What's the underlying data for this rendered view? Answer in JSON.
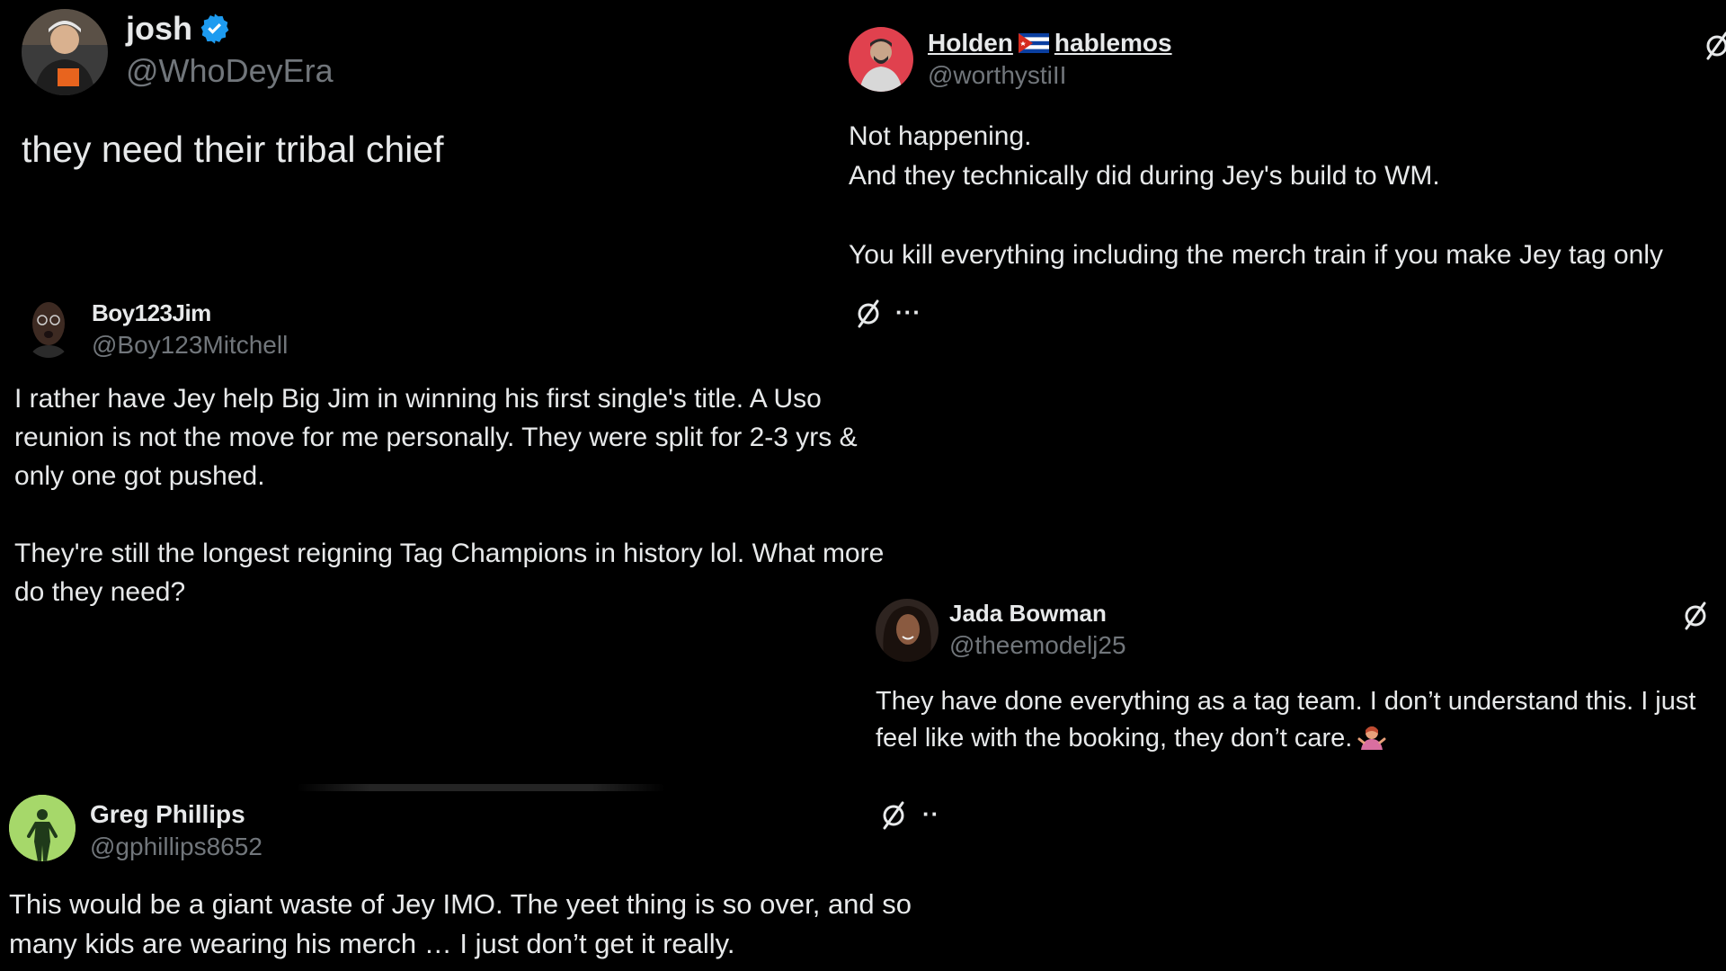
{
  "posts": {
    "josh": {
      "name": "josh",
      "handle": "@WhoDeyEra",
      "text": "they need their tribal chief"
    },
    "holden": {
      "name_part1": "Holden",
      "name_part2": "hablemos",
      "handle": "@worthystiII",
      "text": "Not happening.\nAnd they technically did during Jey's build to WM.\n\nYou kill everything including the merch train if you make Jey tag only"
    },
    "boy123": {
      "name": "Boy123Jim",
      "handle": "@Boy123Mitchell",
      "text": "I rather have Jey help Big Jim in winning his first single's title. A Uso\nreunion is not the move for me personally. They were split for 2-3 yrs &\nonly one got pushed.\n\nThey're still the longest reigning Tag Champions in history lol. What more\ndo they need?",
      "more": "···"
    },
    "jada": {
      "name": "Jada Bowman",
      "handle": "@theemodelj25",
      "text": "They have done everything as a tag team. I don’t understand this. I just\nfeel like with the booking, they don’t care."
    },
    "greg": {
      "name": "Greg Phillips",
      "handle": "@gphillips8652",
      "text": "This would be a giant waste of Jey IMO. The yeet thing is so over, and so\nmany kids are wearing his merch … I just don’t get it really.",
      "more": "··"
    }
  },
  "colors": {
    "background": "#000000",
    "text": "#e7e9ea",
    "handle": "#71767b",
    "verified": "#1d9bf0"
  },
  "icons": {
    "verified": "verified-badge-icon",
    "grok": "grok-icon",
    "more": "more-options-icon",
    "flag": "cuba-flag-icon",
    "emoji": "person-shrugging-emoji"
  }
}
